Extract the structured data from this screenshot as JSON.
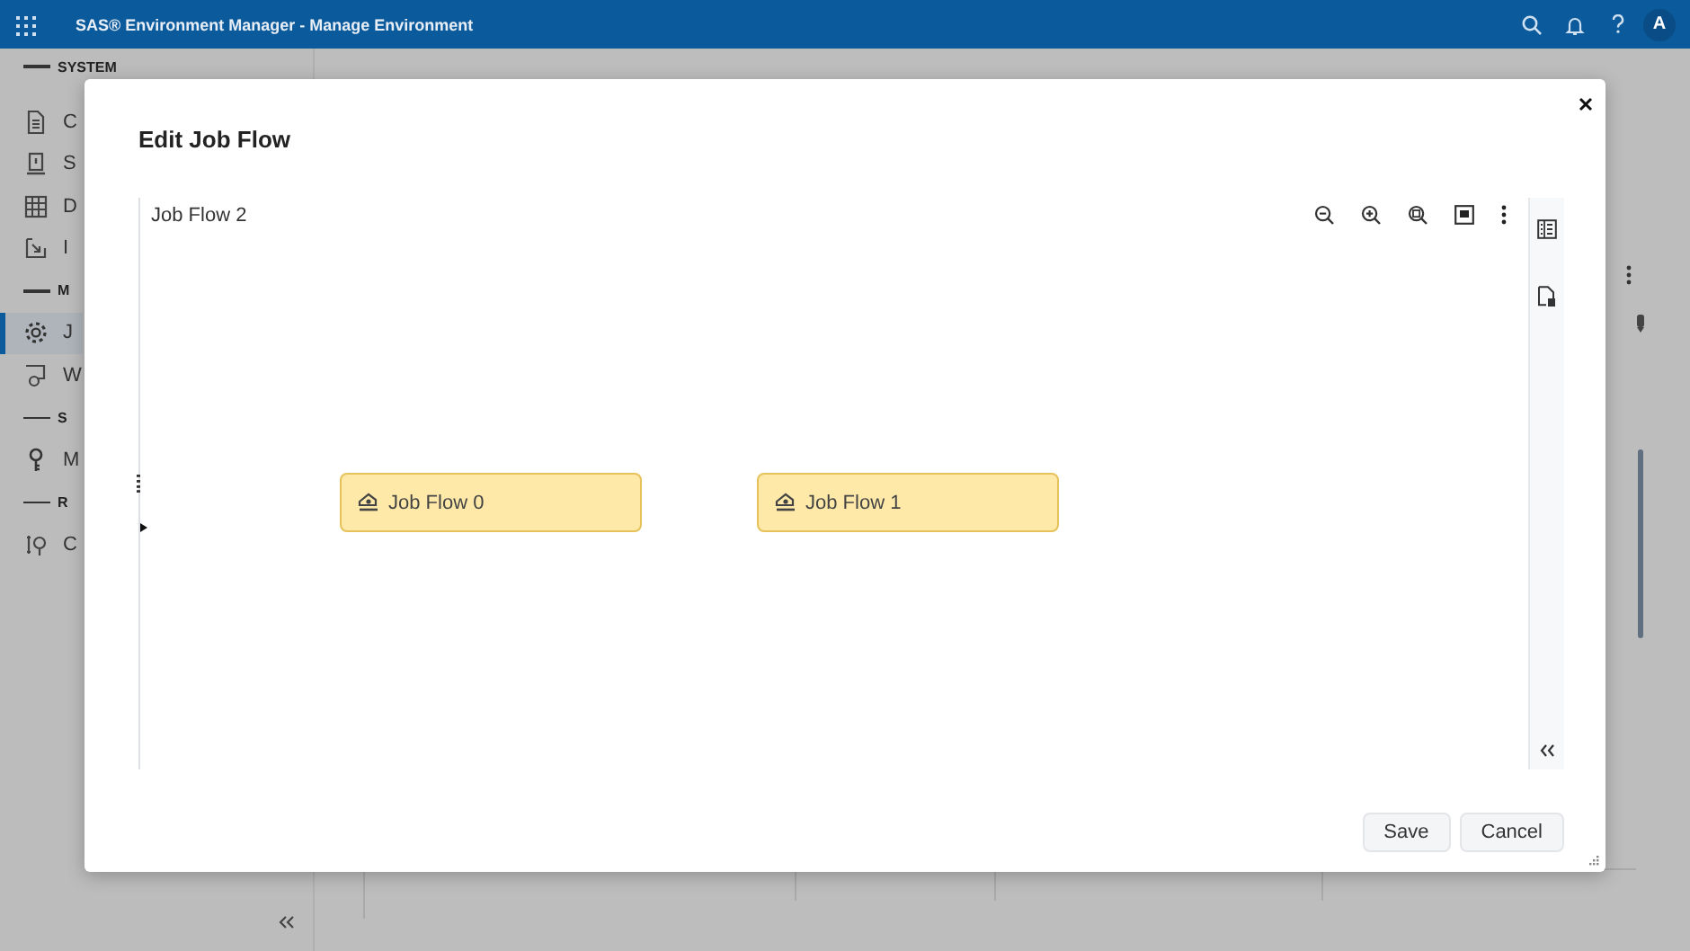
{
  "app_bar": {
    "title": "SAS® Environment Manager - Manage Environment",
    "avatar": "A"
  },
  "sidebar": {
    "items": [
      {
        "kind": "header",
        "label": "SYSTEM"
      },
      {
        "kind": "item",
        "label": "C",
        "selected": false
      },
      {
        "kind": "item",
        "label": "S",
        "selected": false
      },
      {
        "kind": "item",
        "label": "D",
        "selected": false
      },
      {
        "kind": "item",
        "label": "I",
        "selected": false
      },
      {
        "kind": "header",
        "label": "M"
      },
      {
        "kind": "item",
        "label": "J",
        "selected": true
      },
      {
        "kind": "item",
        "label": "W",
        "selected": false
      },
      {
        "kind": "header",
        "label": "S"
      },
      {
        "kind": "item",
        "label": "M",
        "selected": false
      },
      {
        "kind": "header",
        "label": "R"
      },
      {
        "kind": "item",
        "label": "C",
        "selected": false
      }
    ]
  },
  "dialog": {
    "title": "Edit Job Flow",
    "flow_name": "Job Flow 2",
    "nodes": [
      {
        "label": "Job Flow 0"
      },
      {
        "label": "Job Flow 1"
      }
    ],
    "buttons": [
      "Save",
      "Cancel"
    ]
  }
}
